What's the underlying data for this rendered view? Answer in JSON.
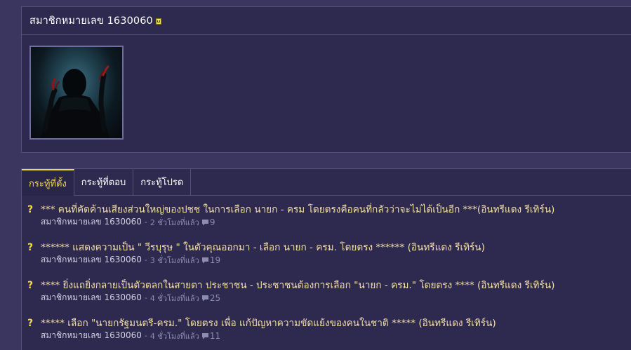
{
  "profile": {
    "name": "สมาชิกหมายเลข 1630060"
  },
  "tabs": [
    {
      "label": "กระทู้ที่ตั้ง",
      "active": true
    },
    {
      "label": "กระทู้ที่ตอบ",
      "active": false
    },
    {
      "label": "กระทู้โปรด",
      "active": false
    }
  ],
  "topics": [
    {
      "icon": "?",
      "title": "*** คนที่คัดค้านเสียงส่วนใหญ่ของปชช ในการเลือก นายก - ครม โดยตรงคือคนที่กลัวว่าจะไม่ได้เป็นอีก ***(อินทรีแดง รีเทิร์น)",
      "author": "สมาชิกหมายเลข 1630060",
      "separator": "-",
      "time": "2 ชั่วโมงที่แล้ว",
      "comments": "9"
    },
    {
      "icon": "?",
      "title": "****** แสดงความเป็น \" วีรบุรุษ \" ในตัวคุณออกมา - เลือก นายก - ครม. โดยตรง ****** (อินทรีแดง รีเทิร์น)",
      "author": "สมาชิกหมายเลข 1630060",
      "separator": "-",
      "time": "3 ชั่วโมงที่แล้ว",
      "comments": "19"
    },
    {
      "icon": "?",
      "title": "**** ยิ่งแถยิ่งกลายเป็นตัวตลกในสายตา ประชาชน - ประชาชนต้องการเลือก \"นายก - ครม.\" โดยตรง **** (อินทรีแดง รีเทิร์น)",
      "author": "สมาชิกหมายเลข 1630060",
      "separator": "-",
      "time": "4 ชั่วโมงที่แล้ว",
      "comments": "25"
    },
    {
      "icon": "?",
      "title": "***** เลือก \"นายกรัฐมนตรี-ครม.\" โดยตรง เพื่อ แก้ปัญหาความขัดแย้งของคนในชาติ ***** (อินทรีแดง รีเทิร์น)",
      "author": "สมาชิกหมายเลข 1630060",
      "separator": "-",
      "time": "4 ชั่วโมงที่แล้ว",
      "comments": "11"
    }
  ],
  "icons": {
    "badge": "member-badge-icon",
    "question": "question-mark-icon",
    "comment": "comment-bubble-icon"
  },
  "colors": {
    "background": "#3a3660",
    "panel": "#2e2a4f",
    "border": "#54507c",
    "accent": "#f2dc3b",
    "topic_title": "#f3dfa6",
    "meta": "#8e8bb0"
  }
}
